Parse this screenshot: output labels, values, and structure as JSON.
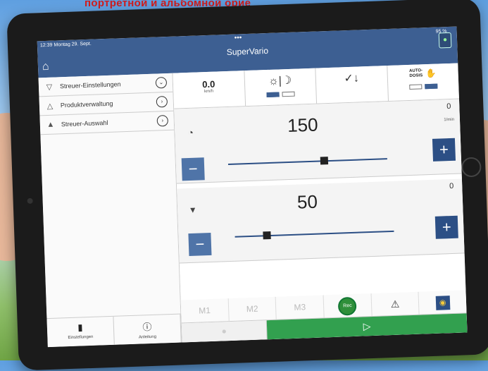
{
  "headline": "портретной и альбомной орие",
  "status": {
    "time": "12:39",
    "date": "Montag 29. Sept.",
    "battery": "95 %",
    "dots": "•••"
  },
  "app": {
    "title": "SuperVario",
    "home_icon": "home-icon",
    "device_icon": "device-icon"
  },
  "sidebar": {
    "items": [
      {
        "label": "Streuer-Einstellungen",
        "icon": "spreader-icon",
        "action": "chevron-down"
      },
      {
        "label": "Produktverwaltung",
        "icon": "product-icon",
        "action": "chevron-right"
      },
      {
        "label": "Streuer-Auswahl",
        "icon": "selection-icon",
        "action": "chevron-right"
      }
    ],
    "bottom": [
      {
        "label": "Einstellungen",
        "icon": "tablet-icon"
      },
      {
        "label": "Anleitung",
        "icon": "info-icon"
      }
    ]
  },
  "tiles": {
    "speed_value": "0.0",
    "speed_unit": "km/h",
    "day_night_icon": "day-night-icon",
    "calibration_icon": "calibration-icon",
    "autodosis_label": "AUTO-\nDOSIS",
    "hand_icon": "hand-icon"
  },
  "rpm_panel": {
    "setpoint": "150",
    "actual": "0",
    "unit": "1/min",
    "slider_fraction": 0.6,
    "icon": "gauge-icon"
  },
  "rate_panel": {
    "setpoint": "50",
    "actual": "0",
    "slider_fraction": 0.2,
    "icon": "spread-icon"
  },
  "memory": {
    "m1": "M1",
    "m2": "M2",
    "m3": "M3",
    "rec": "Rec"
  },
  "actions": {
    "play_icon": "play-icon"
  },
  "colors": {
    "accent": "#3d5f92",
    "button": "#2c4f85",
    "go": "#32a04f",
    "headline": "#d21d1d"
  }
}
